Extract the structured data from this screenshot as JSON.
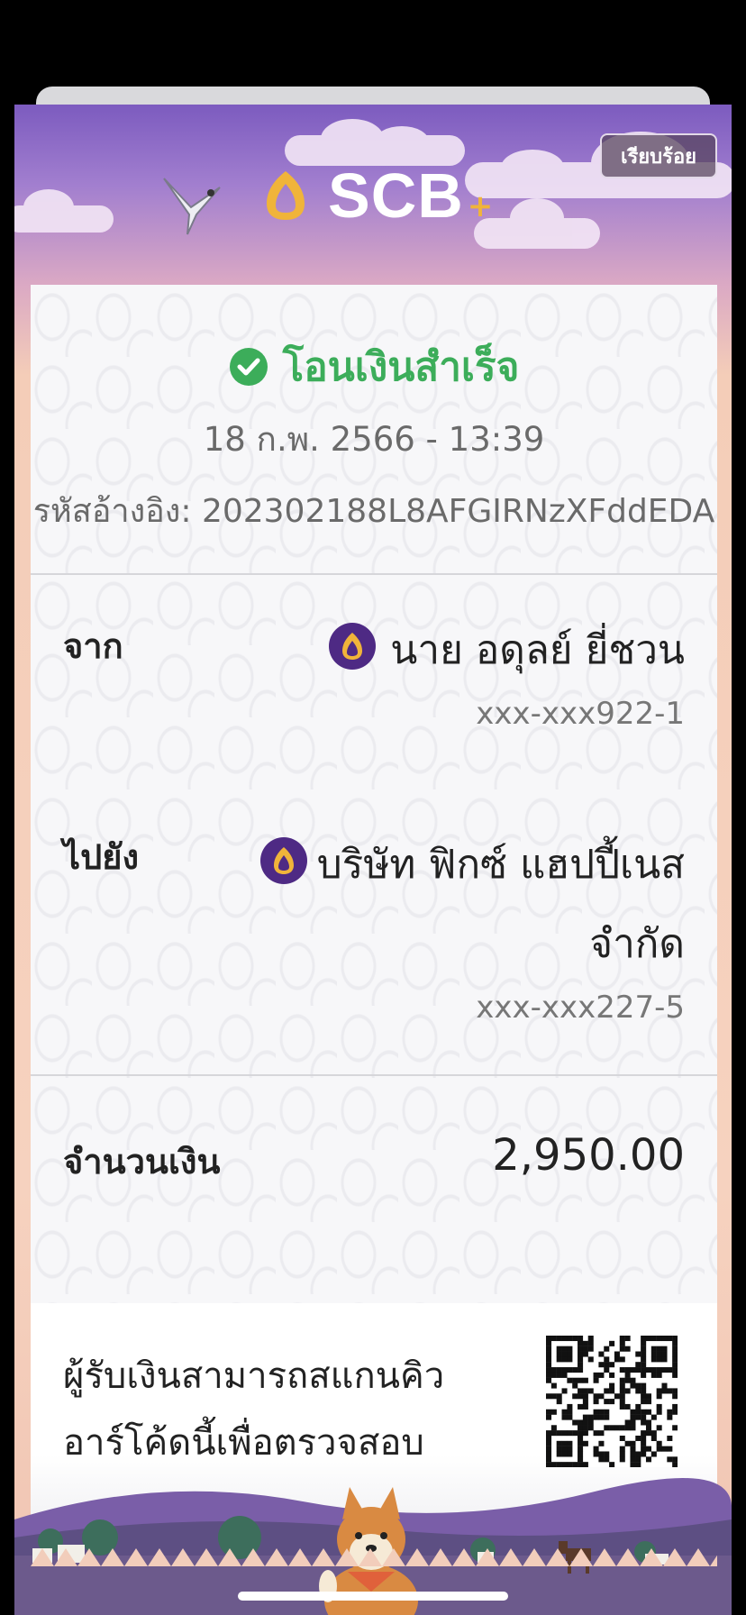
{
  "header": {
    "brand": "SCB",
    "brand_plus": "+",
    "done_label": "เรียบร้อย"
  },
  "colors": {
    "success": "#3cad5a",
    "brand_purple": "#4e2a84",
    "brand_gold": "#f0b43a"
  },
  "receipt": {
    "status": "โอนเงินสำเร็จ",
    "datetime": "18 ก.พ. 2566 - 13:39",
    "reference": "รหัสอ้างอิง: 202302188L8AFGIRNzXFddEDA",
    "from": {
      "label": "จาก",
      "name": "นาย อดุลย์ ยี่ชวน",
      "account": "xxx-xxx922-1"
    },
    "to": {
      "label": "ไปยัง",
      "name_line1": "บริษัท ฟิกซ์ แฮปปี้เนส",
      "name_line2": "จำกัด",
      "account": "xxx-xxx227-5"
    },
    "amount": {
      "label": "จำนวนเงิน",
      "value": "2,950.00"
    },
    "qr_note": {
      "line1": "ผู้รับเงินสามารถสแกนคิว",
      "line2": "อาร์โค้ดนี้เพื่อตรวจสอบ",
      "line3": "-"
    }
  },
  "icons": [
    "check-circle-icon",
    "scb-bank-icon",
    "qr-code-icon",
    "bird-icon",
    "shiba-dog-icon"
  ]
}
